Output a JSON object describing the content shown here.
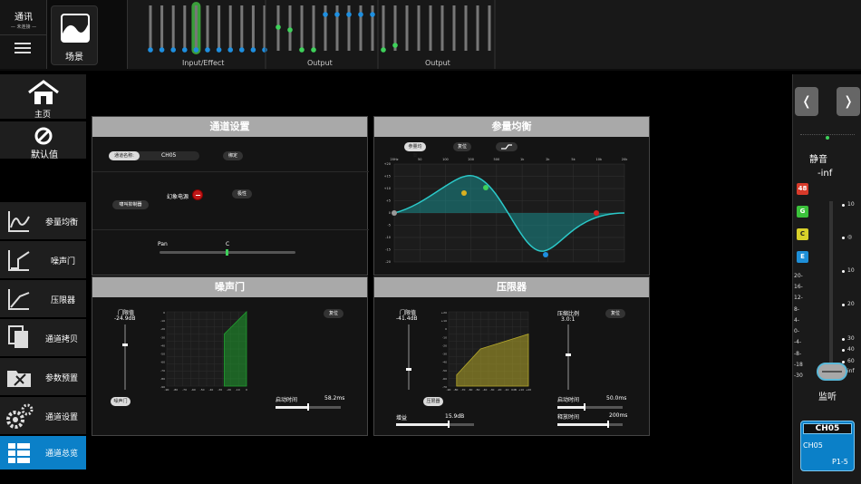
{
  "top": {
    "comm_title": "通讯",
    "comm_status": "— 未连接 —",
    "scene_label": "场景",
    "section_labels": [
      "Input/Effect",
      "Output",
      "Output"
    ]
  },
  "sidebar": {
    "home": "主页",
    "default": "默认值",
    "items": [
      "参量均衡",
      "噪声门",
      "压限器",
      "通道拷贝",
      "参数预置",
      "通道设置",
      "通道总览"
    ]
  },
  "channel_settings": {
    "title": "通道设置",
    "name_label": "通道名称:",
    "name_value": "CH05",
    "bind_label": "绑定",
    "phantom_label": "幻象电源",
    "phase_label": "极性",
    "feedback_label": "啸叫抑制器",
    "pan_label": "Pan",
    "pan_value": "C"
  },
  "peq": {
    "title": "参量均衡",
    "peq_button": "参量均衡",
    "reset_button": "复位",
    "freq_ticks": [
      "20Hz",
      "50",
      "100",
      "200",
      "500",
      "1k",
      "2k",
      "5k",
      "10k",
      "20k"
    ],
    "gain_ticks": [
      "+20",
      "+15",
      "+10",
      "+5",
      "0",
      "-5",
      "-10",
      "-15",
      "-20"
    ]
  },
  "gate": {
    "title": "噪声门",
    "threshold_label": "门限值",
    "threshold_value": "-24.9dB",
    "enable_button": "噪声门",
    "reset_button": "复位",
    "attack_label": "启动时间",
    "attack_value": "58.2ms",
    "yticks": [
      "0",
      "-10",
      "-20",
      "-30",
      "-40",
      "-50",
      "-60",
      "-70",
      "-80",
      "-90"
    ],
    "xticks": [
      "-90",
      "-80",
      "-70",
      "-60",
      "-50",
      "-40",
      "-30",
      "-20",
      "-10",
      "0"
    ]
  },
  "limiter": {
    "title": "压限器",
    "threshold_label": "门限值",
    "threshold_value": "-41.4dB",
    "enable_button": "压限器",
    "reset_button": "复位",
    "gain_label": "增益",
    "gain_value": "15.9dB",
    "ratio_label": "压缩比例",
    "ratio_value": "3.0:1",
    "attack_label": "启动时间",
    "attack_value": "50.0ms",
    "release_label": "释放时间",
    "release_value": "200ms",
    "yticks": [
      "+20",
      "+10",
      "0",
      "-10",
      "-20",
      "-30",
      "-40",
      "-50",
      "-60",
      "-70"
    ],
    "xticks": [
      "-90",
      "-80",
      "-70",
      "-60",
      "-50",
      "-40",
      "-30",
      "-20",
      "-10",
      "0dB",
      "+10",
      "+20"
    ]
  },
  "right": {
    "mute_label": "静音",
    "level": "-inf",
    "tags": [
      "48",
      "G",
      "C",
      "E"
    ],
    "left_scale": [
      "20-",
      "16-",
      "12-",
      "8-",
      "4-",
      "0-",
      "-4-",
      "-8-",
      "-18",
      "-30"
    ],
    "right_scale": [
      "10",
      "◎",
      "10",
      "20",
      "30",
      "40",
      "60",
      "inf"
    ],
    "monitor": "监听",
    "ch_tab": "CH05",
    "ch_name": "CH05",
    "ch_page": "P1-5"
  },
  "colors": {
    "accent": "#0b80c8",
    "eq": "#2bc8c8",
    "gate": "#1f9e2e",
    "limiter": "#b5a82a"
  }
}
